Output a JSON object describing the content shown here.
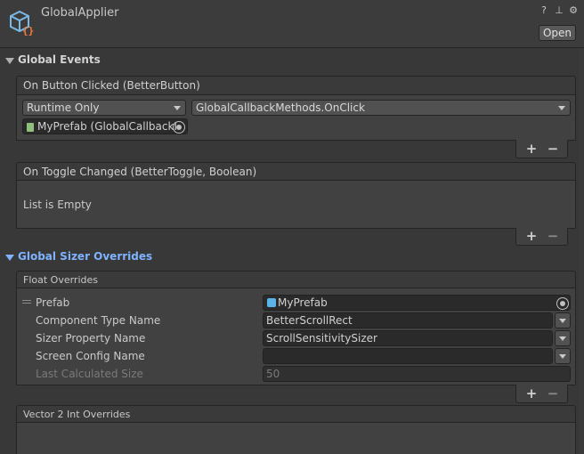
{
  "header": {
    "title": "GlobalApplier",
    "open_label": "Open",
    "icons": [
      "help-icon",
      "preset-icon",
      "settings-icon"
    ],
    "help_glyph": "?",
    "preset_glyph": "⊥",
    "settings_glyph": "⚙"
  },
  "global_events": {
    "label": "Global Events",
    "on_button_clicked": {
      "header": "On Button Clicked (BetterButton)",
      "mode": "Runtime Only",
      "function": "GlobalCallbackMethods.OnClick",
      "target": "MyPrefab (GlobalCallbackI"
    },
    "on_toggle_changed": {
      "header": "On Toggle Changed (BetterToggle, Boolean)",
      "empty_text": "List is Empty"
    },
    "plus": "+",
    "minus": "−"
  },
  "global_sizer_overrides": {
    "label": "Global Sizer Overrides",
    "float_overrides": {
      "header": "Float Overrides",
      "fields": {
        "prefab_label": "Prefab",
        "prefab_value": "MyPrefab",
        "component_type_label": "Component Type Name",
        "component_type_value": "BetterScrollRect",
        "sizer_property_label": "Sizer Property Name",
        "sizer_property_value": "ScrollSensitivitySizer",
        "screen_config_label": "Screen Config Name",
        "screen_config_value": "",
        "last_calc_label": "Last Calculated Size",
        "last_calc_value": "50"
      }
    },
    "vector2int_overrides": {
      "header": "Vector 2 Int Overrides"
    },
    "plus": "+",
    "minus": "−"
  },
  "colors": {
    "background": "#383838",
    "accent_blue": "#7fb3ff",
    "panel": "#414141"
  }
}
